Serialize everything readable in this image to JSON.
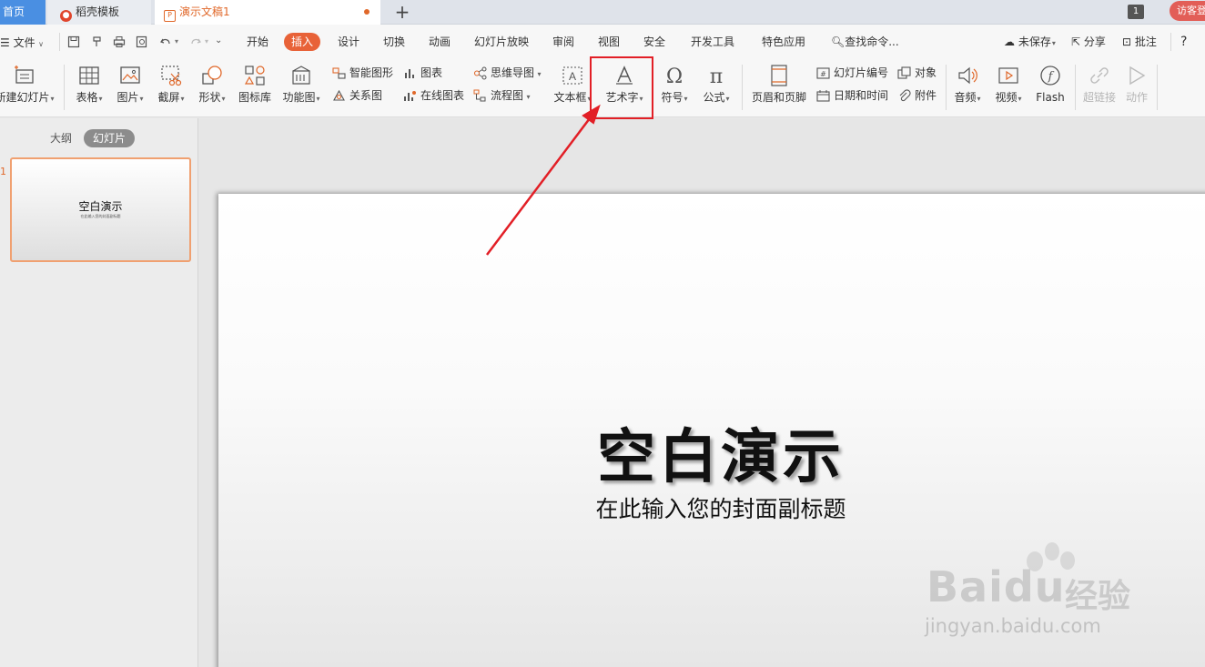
{
  "tabs": {
    "home": "首页",
    "template": "稻壳模板",
    "document": "演示文稿1",
    "count": "1",
    "visitor": "访客登"
  },
  "menu": {
    "file": "文件",
    "tabs": [
      "开始",
      "插入",
      "设计",
      "切换",
      "动画",
      "幻灯片放映",
      "审阅",
      "视图",
      "安全",
      "开发工具",
      "特色应用"
    ],
    "active_tab": "插入",
    "search": "查找命令...",
    "unsaved": "未保存",
    "share": "分享",
    "comment": "批注",
    "help": "?"
  },
  "ribbon": {
    "new_slide": "新建幻灯片",
    "table": "表格",
    "picture": "图片",
    "screenshot": "截屏",
    "shape": "形状",
    "icon_library": "图标库",
    "function_chart": "功能图",
    "smart_art": "智能图形",
    "relation_chart": "关系图",
    "chart": "图表",
    "online_chart": "在线图表",
    "mind_map": "思维导图",
    "flow_chart": "流程图",
    "textbox": "文本框",
    "word_art": "艺术字",
    "symbol": "符号",
    "formula": "公式",
    "header_footer": "页眉和页脚",
    "slide_number": "幻灯片编号",
    "date_time": "日期和时间",
    "object": "对象",
    "attachment": "附件",
    "audio": "音频",
    "video": "视频",
    "flash": "Flash",
    "hyperlink": "超链接",
    "action": "动作"
  },
  "panel": {
    "outline": "大纲",
    "slides": "幻灯片",
    "slide_number": "1"
  },
  "slide": {
    "title": "空白演示",
    "subtitle": "在此输入您的封面副标题"
  },
  "watermark": {
    "logo": "Baidu",
    "cn": "经验",
    "url": "jingyan.baidu.com"
  },
  "colors": {
    "accent": "#e86238",
    "home_tab": "#4a8fe2",
    "highlight": "#e21f26"
  }
}
